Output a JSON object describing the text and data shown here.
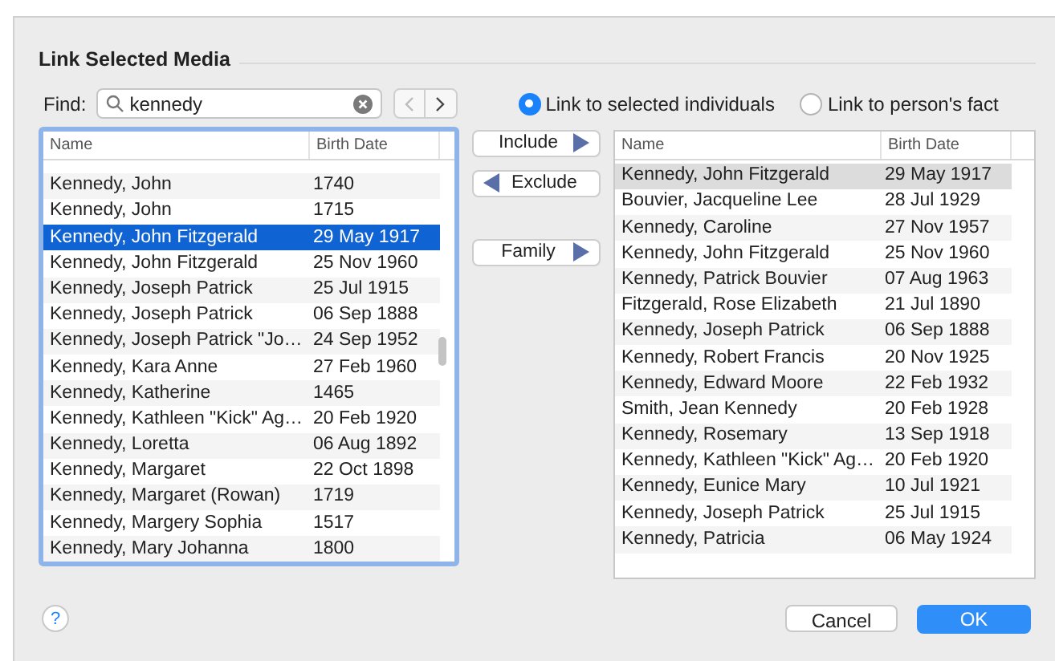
{
  "dialog": {
    "title": "Link Selected Media"
  },
  "find": {
    "label": "Find:",
    "value": "kennedy"
  },
  "link_options": [
    {
      "label": "Link to selected individuals",
      "selected": true
    },
    {
      "label": "Link to person's fact",
      "selected": false
    }
  ],
  "move_buttons": [
    {
      "label": "Include",
      "kind": "right"
    },
    {
      "label": "Exclude",
      "kind": "left"
    },
    {
      "label": "Family",
      "kind": "right"
    }
  ],
  "search_results": {
    "focused": true,
    "columns": [
      "Name",
      "Birth Date"
    ],
    "rows": [
      {
        "name": "Kennedy, John",
        "birth_date": "1740",
        "selected": false
      },
      {
        "name": "Kennedy, John",
        "birth_date": "1715",
        "selected": false
      },
      {
        "name": "Kennedy, John Fitzgerald",
        "birth_date": "29 May 1917",
        "selected": true
      },
      {
        "name": "Kennedy, John Fitzgerald",
        "birth_date": "25 Nov 1960",
        "selected": false
      },
      {
        "name": "Kennedy, Joseph Patrick",
        "birth_date": "25 Jul 1915",
        "selected": false
      },
      {
        "name": "Kennedy, Joseph Patrick",
        "birth_date": "06 Sep 1888",
        "selected": false
      },
      {
        "name": "Kennedy, Joseph Patrick \"Jo…",
        "birth_date": "24 Sep 1952",
        "selected": false
      },
      {
        "name": "Kennedy, Kara Anne",
        "birth_date": "27 Feb 1960",
        "selected": false
      },
      {
        "name": "Kennedy, Katherine",
        "birth_date": "1465",
        "selected": false
      },
      {
        "name": "Kennedy, Kathleen \"Kick\" Ag…",
        "birth_date": "20 Feb 1920",
        "selected": false
      },
      {
        "name": "Kennedy, Loretta",
        "birth_date": "06 Aug 1892",
        "selected": false
      },
      {
        "name": "Kennedy, Margaret",
        "birth_date": "22 Oct 1898",
        "selected": false
      },
      {
        "name": "Kennedy, Margaret (Rowan)",
        "birth_date": "1719",
        "selected": false
      },
      {
        "name": "Kennedy, Margery Sophia",
        "birth_date": "1517",
        "selected": false
      },
      {
        "name": "Kennedy, Mary Johanna",
        "birth_date": "1800",
        "selected": false
      }
    ]
  },
  "linked_individuals": {
    "focused": false,
    "columns": [
      "Name",
      "Birth Date"
    ],
    "rows": [
      {
        "name": "Kennedy, John Fitzgerald",
        "birth_date": "29 May 1917",
        "selected": true
      },
      {
        "name": "Bouvier, Jacqueline Lee",
        "birth_date": "28 Jul 1929",
        "selected": false
      },
      {
        "name": "Kennedy, Caroline",
        "birth_date": "27 Nov 1957",
        "selected": false
      },
      {
        "name": "Kennedy, John Fitzgerald",
        "birth_date": "25 Nov 1960",
        "selected": false
      },
      {
        "name": "Kennedy, Patrick Bouvier",
        "birth_date": "07 Aug 1963",
        "selected": false
      },
      {
        "name": "Fitzgerald, Rose Elizabeth",
        "birth_date": "21 Jul 1890",
        "selected": false
      },
      {
        "name": "Kennedy, Joseph Patrick",
        "birth_date": "06 Sep 1888",
        "selected": false
      },
      {
        "name": "Kennedy, Robert Francis",
        "birth_date": "20 Nov 1925",
        "selected": false
      },
      {
        "name": "Kennedy, Edward Moore",
        "birth_date": "22 Feb 1932",
        "selected": false
      },
      {
        "name": "Smith, Jean Kennedy",
        "birth_date": "20 Feb 1928",
        "selected": false
      },
      {
        "name": "Kennedy, Rosemary",
        "birth_date": "13 Sep 1918",
        "selected": false
      },
      {
        "name": "Kennedy, Kathleen \"Kick\" Ag…",
        "birth_date": "20 Feb 1920",
        "selected": false
      },
      {
        "name": "Kennedy, Eunice Mary",
        "birth_date": "10 Jul 1921",
        "selected": false
      },
      {
        "name": "Kennedy, Joseph Patrick",
        "birth_date": "25 Jul 1915",
        "selected": false
      },
      {
        "name": "Kennedy, Patricia",
        "birth_date": "06 May 1924",
        "selected": false
      }
    ]
  },
  "footer": {
    "help": "?",
    "cancel": "Cancel",
    "ok": "OK"
  }
}
